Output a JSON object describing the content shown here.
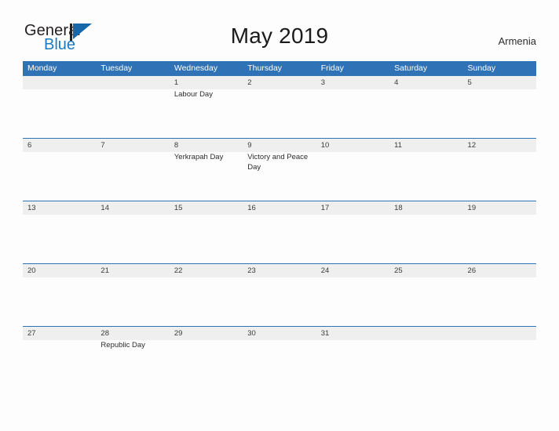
{
  "brand": {
    "name_part1": "General",
    "name_part2": "Blue",
    "logo_icon": "flag-triangle-icon"
  },
  "header": {
    "title": "May 2019",
    "country": "Armenia"
  },
  "colors": {
    "header_blue": "#2f72b5",
    "row_divider_blue": "#2f72b5",
    "date_band_gray": "#efeff0",
    "logo_blue": "#1a7ac4",
    "page_background": "#fdfdfd"
  },
  "calendar": {
    "weekdays": [
      "Monday",
      "Tuesday",
      "Wednesday",
      "Thursday",
      "Friday",
      "Saturday",
      "Sunday"
    ],
    "weeks": [
      [
        {
          "date": "",
          "event": ""
        },
        {
          "date": "",
          "event": ""
        },
        {
          "date": "1",
          "event": "Labour Day"
        },
        {
          "date": "2",
          "event": ""
        },
        {
          "date": "3",
          "event": ""
        },
        {
          "date": "4",
          "event": ""
        },
        {
          "date": "5",
          "event": ""
        }
      ],
      [
        {
          "date": "6",
          "event": ""
        },
        {
          "date": "7",
          "event": ""
        },
        {
          "date": "8",
          "event": "Yerkrapah Day"
        },
        {
          "date": "9",
          "event": "Victory and Peace Day"
        },
        {
          "date": "10",
          "event": ""
        },
        {
          "date": "11",
          "event": ""
        },
        {
          "date": "12",
          "event": ""
        }
      ],
      [
        {
          "date": "13",
          "event": ""
        },
        {
          "date": "14",
          "event": ""
        },
        {
          "date": "15",
          "event": ""
        },
        {
          "date": "16",
          "event": ""
        },
        {
          "date": "17",
          "event": ""
        },
        {
          "date": "18",
          "event": ""
        },
        {
          "date": "19",
          "event": ""
        }
      ],
      [
        {
          "date": "20",
          "event": ""
        },
        {
          "date": "21",
          "event": ""
        },
        {
          "date": "22",
          "event": ""
        },
        {
          "date": "23",
          "event": ""
        },
        {
          "date": "24",
          "event": ""
        },
        {
          "date": "25",
          "event": ""
        },
        {
          "date": "26",
          "event": ""
        }
      ],
      [
        {
          "date": "27",
          "event": ""
        },
        {
          "date": "28",
          "event": "Republic Day"
        },
        {
          "date": "29",
          "event": ""
        },
        {
          "date": "30",
          "event": ""
        },
        {
          "date": "31",
          "event": ""
        },
        {
          "date": "",
          "event": ""
        },
        {
          "date": "",
          "event": ""
        }
      ]
    ]
  }
}
